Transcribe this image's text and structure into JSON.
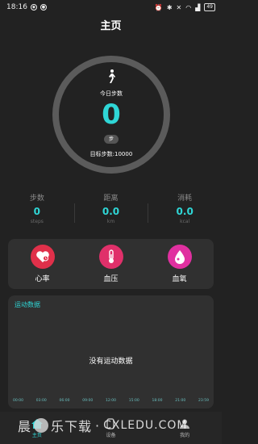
{
  "status_bar": {
    "time": "18:16",
    "battery": "49"
  },
  "header": {
    "title": "主页"
  },
  "steps_ring": {
    "today_label": "今日步数",
    "value": "0",
    "unit": "步",
    "target": "目标步数:10000",
    "progress": 0
  },
  "stats": [
    {
      "title": "步数",
      "value": "0",
      "unit": "steps"
    },
    {
      "title": "距离",
      "value": "0.0",
      "unit": "km"
    },
    {
      "title": "消耗",
      "value": "0.0",
      "unit": "kcal"
    }
  ],
  "health": [
    {
      "label": "心率",
      "icon": "heart-rate-icon",
      "color": "#e0304a"
    },
    {
      "label": "血压",
      "icon": "thermometer-icon",
      "color": "#e0306a"
    },
    {
      "label": "血氧",
      "icon": "blood-drop-icon",
      "color": "#e030a0"
    }
  ],
  "sport": {
    "title": "运动数据",
    "empty_text": "没有运动数据",
    "time_ticks": [
      "00:00",
      "03:00",
      "06:00",
      "09:00",
      "12:00",
      "15:00",
      "18:00",
      "21:00",
      "23:59"
    ]
  },
  "tabs": [
    {
      "label": "主页",
      "icon": "home-icon",
      "active": true
    },
    {
      "label": "设备",
      "icon": "device-icon",
      "active": false
    },
    {
      "label": "我的",
      "icon": "profile-icon",
      "active": false
    }
  ],
  "watermark": {
    "text_a": "晨",
    "text_b": "乐下载",
    "text_c": "·",
    "text_d": "CXLEDU.COM"
  },
  "colors": {
    "accent": "#2fd6d6",
    "background": "#222222",
    "card": "#303030"
  }
}
